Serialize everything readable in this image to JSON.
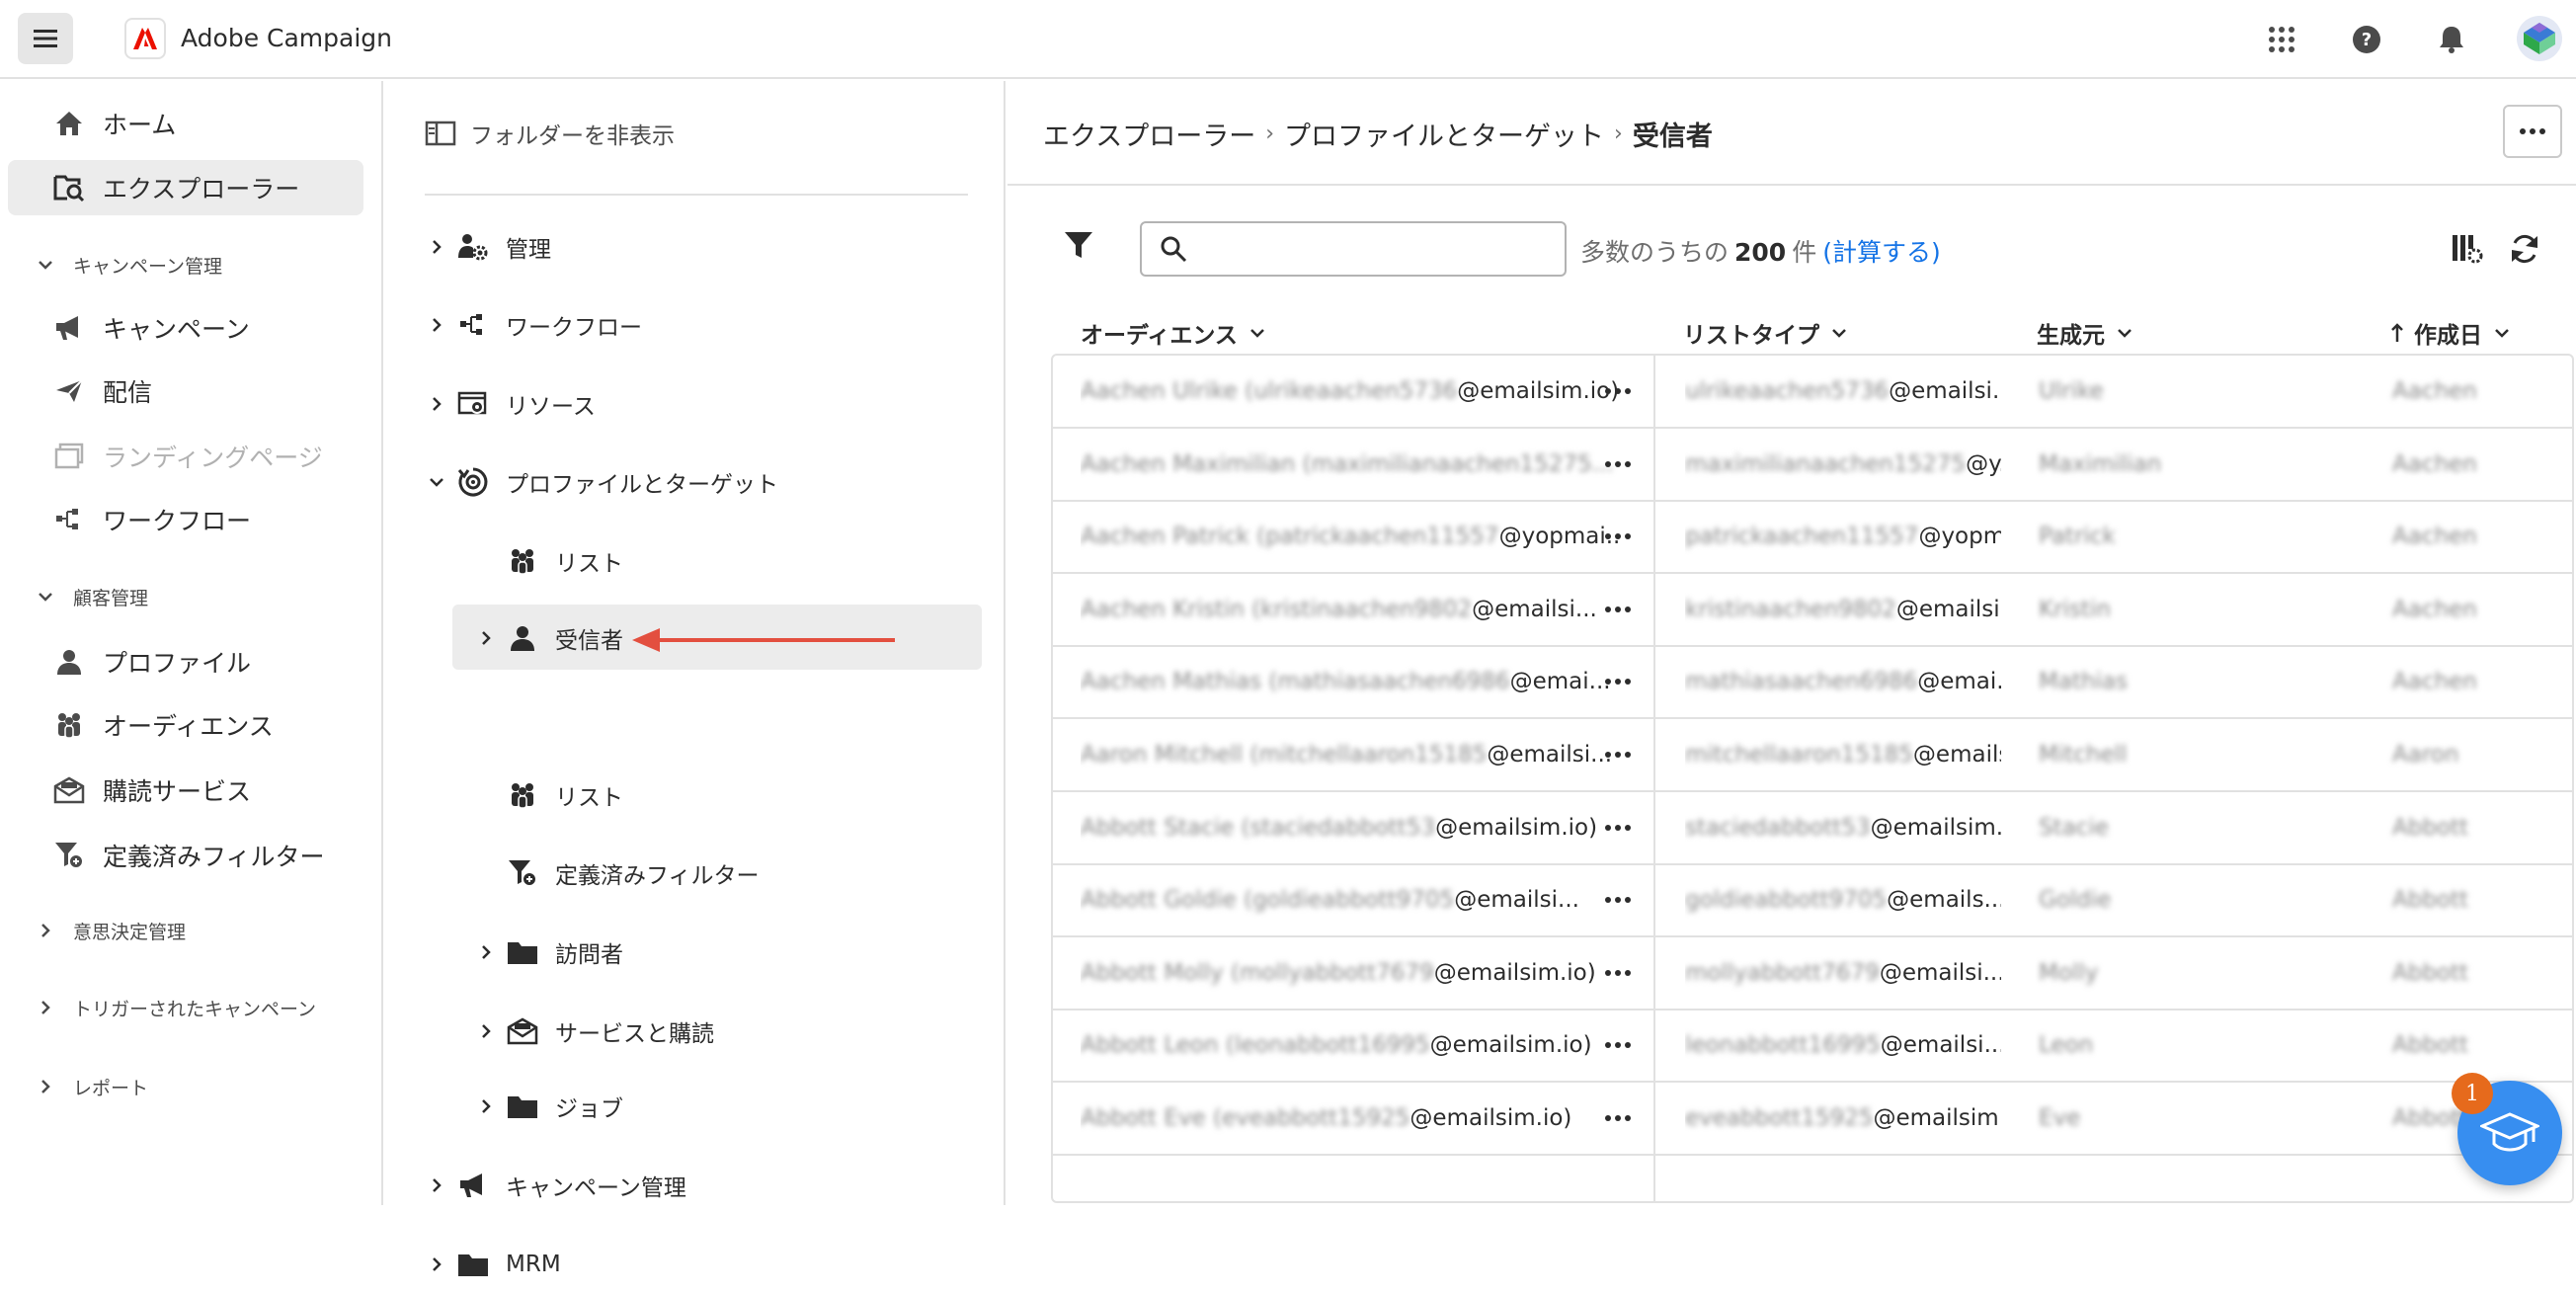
{
  "app": {
    "name": "Adobe Campaign"
  },
  "leftnav": {
    "items": [
      {
        "label": "ホーム",
        "icon": "home-icon"
      },
      {
        "label": "エクスプローラー",
        "icon": "explorer-icon"
      },
      {
        "section": "キャンペーン管理"
      },
      {
        "label": "キャンペーン",
        "icon": "megaphone-icon"
      },
      {
        "label": "配信",
        "icon": "send-icon"
      },
      {
        "label": "ランディングページ",
        "icon": "landing-page-icon"
      },
      {
        "label": "ワークフロー",
        "icon": "workflow-icon"
      },
      {
        "section": "顧客管理"
      },
      {
        "label": "プロファイル",
        "icon": "user-icon"
      },
      {
        "label": "オーディエンス",
        "icon": "audience-icon"
      },
      {
        "label": "購読サービス",
        "icon": "subscription-icon"
      },
      {
        "label": "定義済みフィルター",
        "icon": "filter-icon"
      },
      {
        "section": "意思決定管理"
      },
      {
        "section": "トリガーされたキャンペーン"
      },
      {
        "section": "レポート"
      }
    ]
  },
  "tree": {
    "hide_folders": "フォルダーを非表示",
    "items": [
      {
        "label": "管理"
      },
      {
        "label": "ワークフロー"
      },
      {
        "label": "リソース"
      },
      {
        "label": "プロファイルとターゲット"
      },
      {
        "label": "リスト"
      },
      {
        "label": "受信者"
      },
      {
        "label": "リスト"
      },
      {
        "label": "定義済みフィルター"
      },
      {
        "label": "訪問者"
      },
      {
        "label": "サービスと購読"
      },
      {
        "label": "ジョブ"
      },
      {
        "label": "キャンペーン管理"
      },
      {
        "label": "MRM"
      }
    ]
  },
  "breadcrumb": {
    "items": [
      "エクスプローラー",
      "プロファイルとターゲット"
    ],
    "current": "受信者"
  },
  "search": {
    "placeholder": "",
    "value": ""
  },
  "count": {
    "prefix": "多数のうちの",
    "number": "200",
    "suffix": "件",
    "link_open": "(",
    "link": "計算する",
    "link_close": ")"
  },
  "table": {
    "columns": [
      "オーディエンス",
      "リストタイプ",
      "生成元",
      "作成日"
    ],
    "rows": [
      {
        "name": "Aachen Ulrike (",
        "masked": "ulrikeaachen5736",
        "email": "@emailsim.io)",
        "c2_masked": "ulrikeaachen5736",
        "c2": "@emailsi...",
        "c3": "Ulrike",
        "c4": "Aachen"
      },
      {
        "name": "Aachen Maximilian (",
        "masked": "maximilianaachen15275...",
        "email": "",
        "c2_masked": "maximilianaachen15275",
        "c2": "@y...",
        "c3": "Maximilian",
        "c4": "Aachen"
      },
      {
        "name": "Aachen Patrick (",
        "masked": "patrickaachen11557",
        "email": "@yopmai...",
        "c2_masked": "patrickaachen11557",
        "c2": "@yopm...",
        "c3": "Patrick",
        "c4": "Aachen"
      },
      {
        "name": "Aachen Kristin (",
        "masked": "kristinaachen9802",
        "email": "@emailsi...",
        "c2_masked": "kristinaachen9802",
        "c2": "@emailsi...",
        "c3": "Kristin",
        "c4": "Aachen"
      },
      {
        "name": "Aachen Mathias (",
        "masked": "mathiasaachen6986",
        "email": "@emai...",
        "c2_masked": "mathiasaachen6986",
        "c2": "@emai...",
        "c3": "Mathias",
        "c4": "Aachen"
      },
      {
        "name": "Aaron Mitchell (",
        "masked": "mitchellaaron15185",
        "email": "@emailsi...",
        "c2_masked": "mitchellaaron15185",
        "c2": "@emails...",
        "c3": "Mitchell",
        "c4": "Aaron"
      },
      {
        "name": "Abbott Stacie (",
        "masked": "staciedabbott53",
        "email": "@emailsim.io)",
        "c2_masked": "staciedabbott53",
        "c2": "@emailsim.io",
        "c3": "Stacie",
        "c4": "Abbott"
      },
      {
        "name": "Abbott Goldie (",
        "masked": "goldieabbott9705",
        "email": "@emailsi...",
        "c2_masked": "goldieabbott9705",
        "c2": "@emails...",
        "c3": "Goldie",
        "c4": "Abbott"
      },
      {
        "name": "Abbott Molly (",
        "masked": "mollyabbott7679",
        "email": "@emailsim.io)",
        "c2_masked": "mollyabbott7679",
        "c2": "@emailsi...",
        "c3": "Molly",
        "c4": "Abbott"
      },
      {
        "name": "Abbott Leon (",
        "masked": "leonabbott16995",
        "email": "@emailsim.io)",
        "c2_masked": "leonabbott16995",
        "c2": "@emailsi...",
        "c3": "Leon",
        "c4": "Abbott"
      },
      {
        "name": "Abbott Eve (",
        "masked": "eveabbott15925",
        "email": "@emailsim.io)",
        "c2_masked": "eveabbott15925",
        "c2": "@emailsim.io",
        "c3": "Eve",
        "c4": "Abbott"
      }
    ]
  },
  "learn": {
    "badge": "1"
  },
  "colors": {
    "accent": "#1473e6",
    "brand_red": "#eb1000",
    "arrow_red": "#e34f3f",
    "learn_blue": "#378ef0",
    "badge_orange": "#e66a1c"
  }
}
